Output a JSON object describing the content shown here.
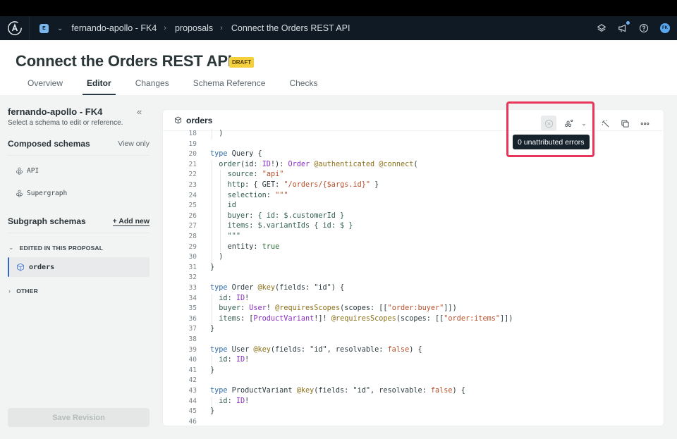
{
  "top_nav": {
    "org_initial": "E",
    "breadcrumbs": [
      "fernando-apollo - FK4",
      "proposals",
      "Connect the Orders REST API"
    ],
    "avatar_initials": "FK"
  },
  "header": {
    "title": "Connect the Orders REST API",
    "badge": "DRAFT",
    "tabs": [
      {
        "label": "Overview",
        "active": false
      },
      {
        "label": "Editor",
        "active": true
      },
      {
        "label": "Changes",
        "active": false
      },
      {
        "label": "Schema Reference",
        "active": false
      },
      {
        "label": "Checks",
        "active": false
      }
    ]
  },
  "sidebar": {
    "title": "fernando-apollo - FK4",
    "subtitle": "Select a schema to edit or reference.",
    "composed": {
      "title": "Composed schemas",
      "action": "View only",
      "items": [
        "API",
        "Supergraph"
      ]
    },
    "subgraph": {
      "title": "Subgraph schemas",
      "action": "+ Add new",
      "groups": [
        {
          "label": "EDITED IN THIS PROPOSAL",
          "expanded": true,
          "items": [
            "orders"
          ]
        },
        {
          "label": "OTHER",
          "expanded": false,
          "items": []
        }
      ]
    },
    "save_button": "Save Revision"
  },
  "editor": {
    "file_name": "orders",
    "tooltip": "0 unattributed errors",
    "lines": [
      {
        "n": 18,
        "indent": 1,
        "tokens": [
          [
            "p",
            ")"
          ]
        ]
      },
      {
        "n": 19,
        "indent": 0,
        "tokens": []
      },
      {
        "n": 20,
        "indent": 0,
        "tokens": [
          [
            "k",
            "type"
          ],
          [
            "p",
            " Query {"
          ]
        ]
      },
      {
        "n": 21,
        "indent": 1,
        "tokens": [
          [
            "f",
            "order"
          ],
          [
            "p",
            "(id: "
          ],
          [
            "t",
            "ID"
          ],
          [
            "p",
            "!): "
          ],
          [
            "t",
            "Order"
          ],
          [
            "p",
            " "
          ],
          [
            "d",
            "@authenticated"
          ],
          [
            "p",
            " "
          ],
          [
            "d",
            "@connect"
          ],
          [
            "p",
            "("
          ]
        ]
      },
      {
        "n": 22,
        "indent": 2,
        "tokens": [
          [
            "f",
            "source"
          ],
          [
            "p",
            ": "
          ],
          [
            "s",
            "\"api\""
          ]
        ]
      },
      {
        "n": 23,
        "indent": 2,
        "tokens": [
          [
            "f",
            "http"
          ],
          [
            "p",
            ": { GET: "
          ],
          [
            "s",
            "\"/orders/{$args.id}\""
          ],
          [
            "p",
            " }"
          ]
        ]
      },
      {
        "n": 24,
        "indent": 2,
        "tokens": [
          [
            "f",
            "selection"
          ],
          [
            "p",
            ": "
          ],
          [
            "s",
            "\"\"\""
          ]
        ]
      },
      {
        "n": 25,
        "indent": 2,
        "tokens": [
          [
            "f",
            "id"
          ]
        ]
      },
      {
        "n": 26,
        "indent": 2,
        "tokens": [
          [
            "f",
            "buyer: { id: $.customerId }"
          ]
        ]
      },
      {
        "n": 27,
        "indent": 2,
        "tokens": [
          [
            "f",
            "items: $.variantIds { id: $ }"
          ]
        ]
      },
      {
        "n": 28,
        "indent": 2,
        "tokens": [
          [
            "f",
            "\"\"\""
          ]
        ]
      },
      {
        "n": 29,
        "indent": 2,
        "tokens": [
          [
            "p",
            "entity: "
          ],
          [
            "lit",
            "true"
          ]
        ]
      },
      {
        "n": 30,
        "indent": 1,
        "tokens": [
          [
            "p",
            ")"
          ]
        ]
      },
      {
        "n": 31,
        "indent": 0,
        "tokens": [
          [
            "p",
            "}"
          ]
        ]
      },
      {
        "n": 32,
        "indent": 0,
        "tokens": []
      },
      {
        "n": 33,
        "indent": 0,
        "tokens": [
          [
            "k",
            "type"
          ],
          [
            "p",
            " Order "
          ],
          [
            "d",
            "@key"
          ],
          [
            "p",
            "(fields: "
          ],
          [
            "p",
            "\"id\""
          ],
          [
            "p",
            ") {"
          ]
        ]
      },
      {
        "n": 34,
        "indent": 1,
        "tokens": [
          [
            "f",
            "id"
          ],
          [
            "p",
            ": "
          ],
          [
            "t",
            "ID"
          ],
          [
            "p",
            "!"
          ]
        ]
      },
      {
        "n": 35,
        "indent": 1,
        "tokens": [
          [
            "f",
            "buyer"
          ],
          [
            "p",
            ": "
          ],
          [
            "t",
            "User"
          ],
          [
            "p",
            "! "
          ],
          [
            "d",
            "@requiresScopes"
          ],
          [
            "p",
            "(scopes: [["
          ],
          [
            "s",
            "\"order:buyer\""
          ],
          [
            "p",
            "]])"
          ]
        ]
      },
      {
        "n": 36,
        "indent": 1,
        "tokens": [
          [
            "f",
            "items"
          ],
          [
            "p",
            ": ["
          ],
          [
            "t",
            "ProductVariant"
          ],
          [
            "p",
            "!]! "
          ],
          [
            "d",
            "@requiresScopes"
          ],
          [
            "p",
            "(scopes: [["
          ],
          [
            "s",
            "\"order:items\""
          ],
          [
            "p",
            "]])"
          ]
        ]
      },
      {
        "n": 37,
        "indent": 0,
        "tokens": [
          [
            "p",
            "}"
          ]
        ]
      },
      {
        "n": 38,
        "indent": 0,
        "tokens": []
      },
      {
        "n": 39,
        "indent": 0,
        "tokens": [
          [
            "k",
            "type"
          ],
          [
            "p",
            " User "
          ],
          [
            "d",
            "@key"
          ],
          [
            "p",
            "(fields: "
          ],
          [
            "p",
            "\"id\""
          ],
          [
            "p",
            ", resolvable: "
          ],
          [
            "b",
            "false"
          ],
          [
            "p",
            ") {"
          ]
        ]
      },
      {
        "n": 40,
        "indent": 1,
        "tokens": [
          [
            "f",
            "id"
          ],
          [
            "p",
            ": "
          ],
          [
            "t",
            "ID"
          ],
          [
            "p",
            "!"
          ]
        ]
      },
      {
        "n": 41,
        "indent": 0,
        "tokens": [
          [
            "p",
            "}"
          ]
        ]
      },
      {
        "n": 42,
        "indent": 0,
        "tokens": []
      },
      {
        "n": 43,
        "indent": 0,
        "tokens": [
          [
            "k",
            "type"
          ],
          [
            "p",
            " ProductVariant "
          ],
          [
            "d",
            "@key"
          ],
          [
            "p",
            "(fields: "
          ],
          [
            "p",
            "\"id\""
          ],
          [
            "p",
            ", resolvable: "
          ],
          [
            "b",
            "false"
          ],
          [
            "p",
            ") {"
          ]
        ]
      },
      {
        "n": 44,
        "indent": 1,
        "tokens": [
          [
            "f",
            "id"
          ],
          [
            "p",
            ": "
          ],
          [
            "t",
            "ID"
          ],
          [
            "p",
            "!"
          ]
        ]
      },
      {
        "n": 45,
        "indent": 0,
        "tokens": [
          [
            "p",
            "}"
          ]
        ]
      },
      {
        "n": 46,
        "indent": 0,
        "tokens": []
      }
    ]
  }
}
